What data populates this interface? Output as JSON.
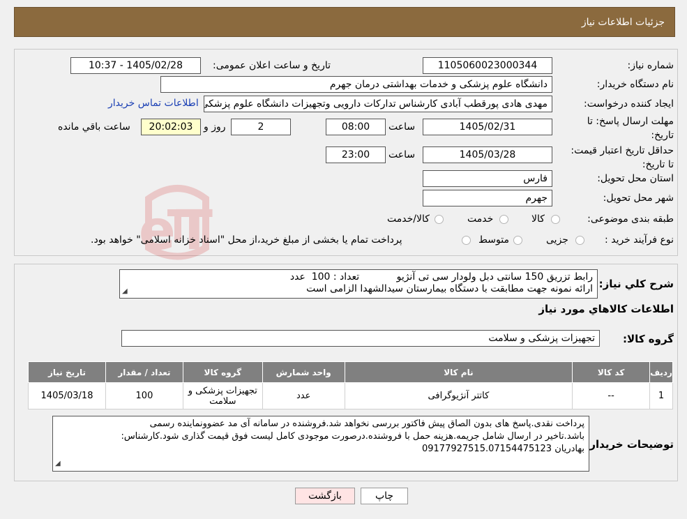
{
  "header": {
    "title": "جزئیات اطلاعات نیاز"
  },
  "form": {
    "need_number_label": "شماره نیاز:",
    "need_number": "1105060023000344",
    "announce_label": "تاریخ و ساعت اعلان عمومی:",
    "announce_value": "1405/02/28 - 10:37",
    "buyer_org_label": "نام دستگاه خریدار:",
    "buyer_org": "دانشگاه علوم پزشکی و خدمات بهداشتی  درمان جهرم",
    "creator_label": "ایجاد کننده درخواست:",
    "creator": "مهدی هادی پورقطب آبادی کارشناس تدارکات دارویی وتجهیزات دانشگاه علوم پزشکی",
    "contact_link": "اطلاعات تماس خریدار",
    "deadline_label": "مهلت ارسال پاسخ: تا تاریخ:",
    "deadline_date": "1405/02/31",
    "time_label": "ساعت",
    "deadline_time": "08:00",
    "days_count": "2",
    "days_and_label": "روز و",
    "remaining_time": "20:02:03",
    "remaining_label": "ساعت باقي مانده",
    "price_validity_label": "حداقل تاریخ اعتبار قیمت: تا تاریخ:",
    "price_validity_date": "1405/03/28",
    "price_validity_time": "23:00",
    "province_label": "استان محل تحویل:",
    "province": "فارس",
    "city_label": "شهر محل تحویل:",
    "city": "جهرم",
    "category_label": "طبقه بندی موضوعی:",
    "category_options": [
      "کالا",
      "خدمت",
      "کالا/خدمت"
    ],
    "purchase_type_label": "نوع فرآیند خرید :",
    "purchase_type_options": [
      "جزیی",
      "متوسط"
    ],
    "purchase_note": "پرداخت تمام یا بخشی از مبلغ خرید،از محل \"اسناد خزانه اسلامی\" خواهد بود."
  },
  "summary": {
    "label": "شرح کلي نياز:",
    "line1": "رابط تزریق 150 سانتی دبل ولودار سی تی آنژیو            تعداد : 100  عدد",
    "line2": "ارائه نمونه جهت مطابقت با دستگاه بیمارستان سیدالشهدا الزامی است"
  },
  "goods": {
    "section_title": "اطلاعات کالاهاي مورد نياز",
    "group_label": "گروه کالا:",
    "group_value": "تجهیزات پزشکی و سلامت",
    "columns": [
      "ردیف",
      "کد کالا",
      "نام کالا",
      "واحد شمارش",
      "گروه کالا",
      "تعداد / مقدار",
      "تاریخ نیاز"
    ],
    "rows": [
      {
        "row": "1",
        "code": "--",
        "name": "کاتتر آنژیوگرافی",
        "unit": "عدد",
        "group": "تجهیزات پزشکی و سلامت",
        "qty": "100",
        "date": "1405/03/18"
      }
    ]
  },
  "buyer_notes": {
    "label": "توضیحات خریدار:",
    "line1": "پرداخت نقدی.پاسخ های بدون الصاق پیش فاکتور بررسی نخواهد شد.فروشنده در سامانه آی مد عضوونماینده رسمی",
    "line2": "باشد.تاخیر در ارسال شامل جریمه.هزینه حمل با فروشنده.درصورت موجودی کامل لیست فوق قیمت گذاری شود.کارشناس:",
    "line3": "بهادریان 09177927515.07154475123"
  },
  "buttons": {
    "print": "چاپ",
    "back": "بازگشت"
  },
  "colors": {
    "header": "#8b6a3e",
    "table_header": "#808080",
    "highlight": "#ffffcc",
    "back_button": "#ffe4e4"
  }
}
